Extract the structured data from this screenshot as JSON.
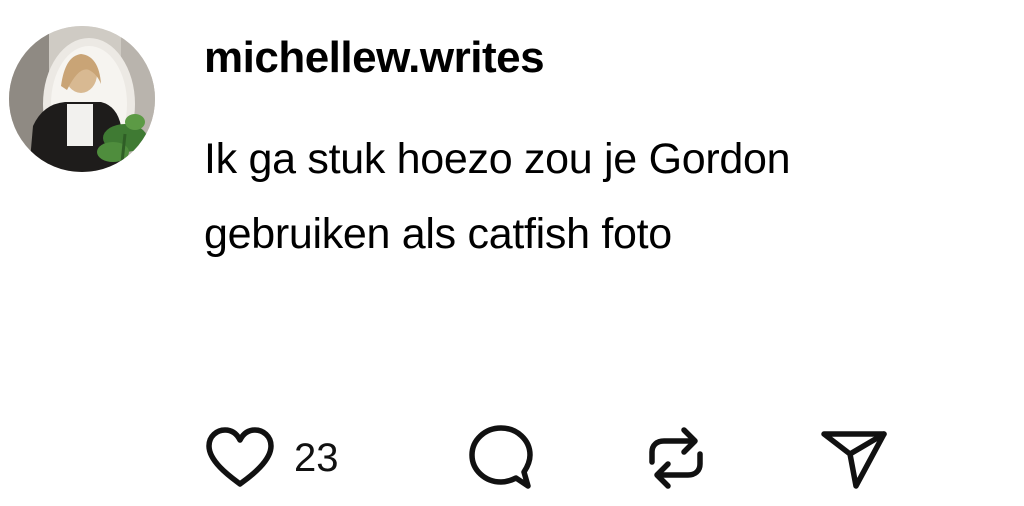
{
  "post": {
    "username": "michellew.writes",
    "text_lines": [
      "Ik ga stuk hoezo zou je Gordon",
      "gebruiken als catfish foto"
    ],
    "likes": "23"
  },
  "icons": {
    "like": "heart-icon",
    "reply": "comment-icon",
    "repost": "repost-icon",
    "share": "send-icon"
  },
  "colors": {
    "text": "#000000",
    "icon_stroke": "#111111",
    "background": "#ffffff"
  }
}
